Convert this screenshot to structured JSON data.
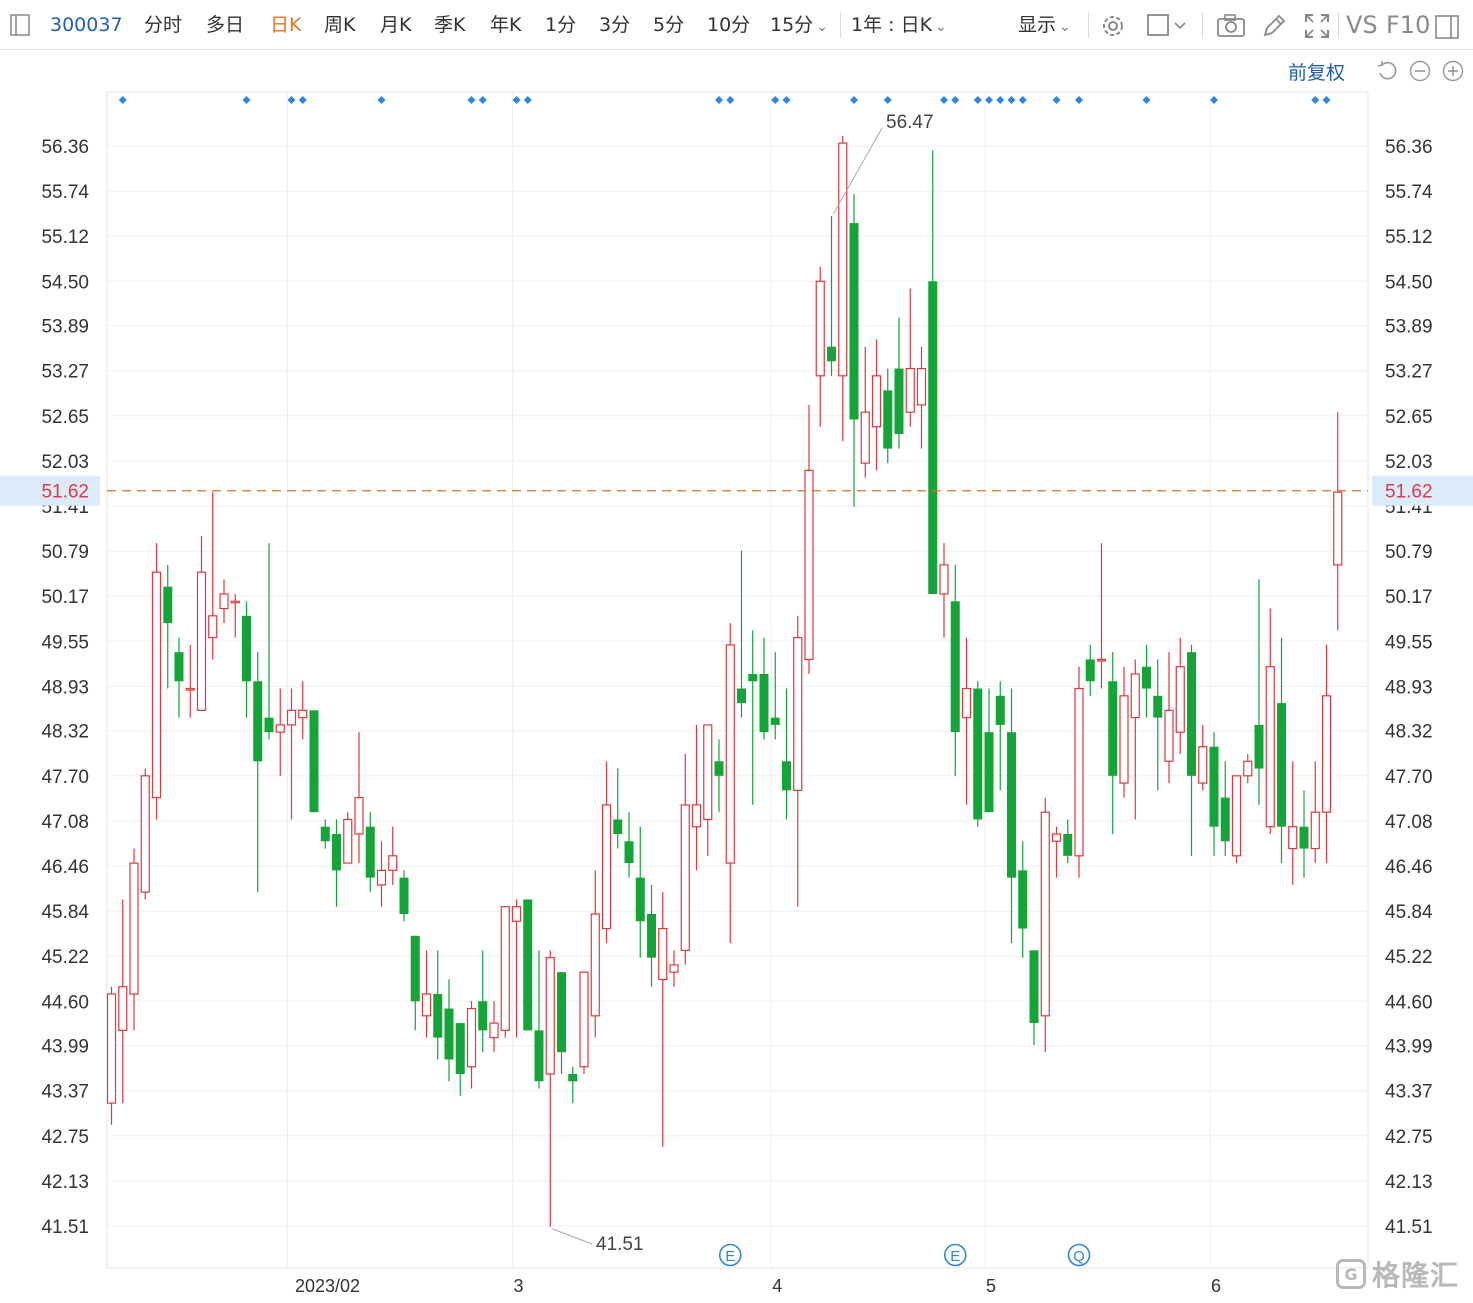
{
  "toolbar": {
    "code": "300037",
    "tabs": [
      "分时",
      "多日",
      "日K",
      "周K",
      "月K",
      "季K",
      "年K",
      "1分",
      "3分",
      "5分",
      "10分",
      "15分"
    ],
    "active_tab": "日K",
    "period": "1年 : 日K",
    "display": "显示",
    "vs": "VS",
    "f10": "F10"
  },
  "adjust_label": "前复权",
  "colors": {
    "up": "#e0393e",
    "down": "#13a538",
    "current": "#e8741b",
    "axis_text": "#333333",
    "link": "#1f5fb5"
  },
  "logo": {
    "text": "格隆汇"
  },
  "chart_data": {
    "type": "candlestick",
    "title": "",
    "xlabel": "",
    "ylabel": "",
    "y_ticks": [
      56.36,
      55.74,
      55.12,
      54.5,
      53.89,
      53.27,
      52.65,
      52.03,
      51.41,
      50.79,
      50.17,
      49.55,
      48.93,
      48.32,
      47.7,
      47.08,
      46.46,
      45.84,
      45.22,
      44.6,
      43.99,
      43.37,
      42.75,
      42.13,
      41.51
    ],
    "ylim": [
      41.51,
      56.36
    ],
    "x_tick_labels": [
      "2023/02",
      "3",
      "4",
      "5",
      "6"
    ],
    "x_tick_index": [
      16,
      36,
      59,
      78,
      98
    ],
    "current_price": 51.62,
    "max_label": "56.47",
    "min_label": "41.51",
    "max_index": 64,
    "min_index": 39,
    "event_markers": [
      {
        "label": "E",
        "index": 55
      },
      {
        "label": "E",
        "index": 75
      },
      {
        "label": "Q",
        "index": 86
      }
    ],
    "top_markers_index": [
      1,
      12,
      16,
      17,
      24,
      32,
      33,
      36,
      37,
      54,
      55,
      59,
      60,
      66,
      69,
      74,
      75,
      77,
      78,
      79,
      80,
      81,
      84,
      86,
      92,
      98,
      107,
      108
    ],
    "candles": [
      {
        "o": 43.2,
        "h": 44.8,
        "l": 42.9,
        "c": 44.7
      },
      {
        "o": 44.2,
        "h": 46.0,
        "l": 43.2,
        "c": 44.8
      },
      {
        "o": 44.7,
        "h": 46.7,
        "l": 44.2,
        "c": 46.5
      },
      {
        "o": 46.1,
        "h": 47.8,
        "l": 46.0,
        "c": 47.7
      },
      {
        "o": 47.4,
        "h": 50.9,
        "l": 47.1,
        "c": 50.5
      },
      {
        "o": 50.3,
        "h": 50.6,
        "l": 48.9,
        "c": 49.8
      },
      {
        "o": 49.4,
        "h": 49.6,
        "l": 48.5,
        "c": 49.0
      },
      {
        "o": 48.9,
        "h": 49.5,
        "l": 48.5,
        "c": 48.9
      },
      {
        "o": 48.6,
        "h": 51.0,
        "l": 48.6,
        "c": 50.5
      },
      {
        "o": 49.6,
        "h": 51.6,
        "l": 49.3,
        "c": 49.9
      },
      {
        "o": 50.0,
        "h": 50.4,
        "l": 49.8,
        "c": 50.2
      },
      {
        "o": 50.1,
        "h": 50.2,
        "l": 49.6,
        "c": 50.1
      },
      {
        "o": 49.9,
        "h": 50.1,
        "l": 48.5,
        "c": 49.0
      },
      {
        "o": 49.0,
        "h": 49.4,
        "l": 46.1,
        "c": 47.9
      },
      {
        "o": 48.5,
        "h": 50.9,
        "l": 48.2,
        "c": 48.3
      },
      {
        "o": 48.3,
        "h": 48.9,
        "l": 47.7,
        "c": 48.4
      },
      {
        "o": 48.4,
        "h": 48.9,
        "l": 47.1,
        "c": 48.6
      },
      {
        "o": 48.5,
        "h": 49.0,
        "l": 48.2,
        "c": 48.6
      },
      {
        "o": 48.6,
        "h": 48.6,
        "l": 47.2,
        "c": 47.2
      },
      {
        "o": 47.0,
        "h": 47.1,
        "l": 46.7,
        "c": 46.8
      },
      {
        "o": 46.9,
        "h": 47.1,
        "l": 45.9,
        "c": 46.4
      },
      {
        "o": 46.5,
        "h": 47.2,
        "l": 46.5,
        "c": 47.1
      },
      {
        "o": 46.9,
        "h": 48.3,
        "l": 46.5,
        "c": 47.4
      },
      {
        "o": 47.0,
        "h": 47.2,
        "l": 46.1,
        "c": 46.3
      },
      {
        "o": 46.2,
        "h": 46.8,
        "l": 45.9,
        "c": 46.4
      },
      {
        "o": 46.4,
        "h": 47.0,
        "l": 46.2,
        "c": 46.6
      },
      {
        "o": 46.3,
        "h": 46.4,
        "l": 45.7,
        "c": 45.8
      },
      {
        "o": 45.5,
        "h": 45.5,
        "l": 44.2,
        "c": 44.6
      },
      {
        "o": 44.4,
        "h": 45.3,
        "l": 44.1,
        "c": 44.7
      },
      {
        "o": 44.7,
        "h": 45.3,
        "l": 43.8,
        "c": 44.1
      },
      {
        "o": 44.5,
        "h": 44.9,
        "l": 43.5,
        "c": 43.8
      },
      {
        "o": 44.3,
        "h": 44.3,
        "l": 43.3,
        "c": 43.6
      },
      {
        "o": 43.7,
        "h": 44.6,
        "l": 43.4,
        "c": 44.5
      },
      {
        "o": 44.6,
        "h": 45.3,
        "l": 43.9,
        "c": 44.2
      },
      {
        "o": 44.1,
        "h": 44.6,
        "l": 43.9,
        "c": 44.3
      },
      {
        "o": 44.2,
        "h": 45.8,
        "l": 44.1,
        "c": 45.9
      },
      {
        "o": 45.7,
        "h": 46.0,
        "l": 44.1,
        "c": 45.9
      },
      {
        "o": 46.0,
        "h": 46.0,
        "l": 44.2,
        "c": 44.2
      },
      {
        "o": 44.2,
        "h": 45.3,
        "l": 43.4,
        "c": 43.5
      },
      {
        "o": 43.6,
        "h": 45.3,
        "l": 41.5,
        "c": 45.2
      },
      {
        "o": 45.0,
        "h": 45.0,
        "l": 43.6,
        "c": 43.9
      },
      {
        "o": 43.6,
        "h": 43.7,
        "l": 43.2,
        "c": 43.5
      },
      {
        "o": 43.7,
        "h": 44.7,
        "l": 43.6,
        "c": 45.0
      },
      {
        "o": 44.4,
        "h": 46.4,
        "l": 44.1,
        "c": 45.8
      },
      {
        "o": 45.6,
        "h": 47.9,
        "l": 45.4,
        "c": 47.3
      },
      {
        "o": 47.1,
        "h": 47.8,
        "l": 46.7,
        "c": 46.9
      },
      {
        "o": 46.8,
        "h": 47.2,
        "l": 46.3,
        "c": 46.5
      },
      {
        "o": 46.3,
        "h": 47.0,
        "l": 45.2,
        "c": 45.7
      },
      {
        "o": 45.8,
        "h": 46.2,
        "l": 44.8,
        "c": 45.2
      },
      {
        "o": 44.9,
        "h": 46.1,
        "l": 42.6,
        "c": 45.6
      },
      {
        "o": 45.0,
        "h": 45.3,
        "l": 44.8,
        "c": 45.1
      },
      {
        "o": 45.3,
        "h": 48.0,
        "l": 45.1,
        "c": 47.3
      },
      {
        "o": 47.0,
        "h": 48.4,
        "l": 46.4,
        "c": 47.3
      },
      {
        "o": 47.1,
        "h": 48.4,
        "l": 46.6,
        "c": 48.4
      },
      {
        "o": 47.9,
        "h": 48.2,
        "l": 47.2,
        "c": 47.7
      },
      {
        "o": 46.5,
        "h": 49.8,
        "l": 45.4,
        "c": 49.5
      },
      {
        "o": 48.9,
        "h": 50.8,
        "l": 48.5,
        "c": 48.7
      },
      {
        "o": 49.1,
        "h": 49.7,
        "l": 47.3,
        "c": 49.0
      },
      {
        "o": 49.1,
        "h": 49.6,
        "l": 48.2,
        "c": 48.3
      },
      {
        "o": 48.5,
        "h": 49.4,
        "l": 48.2,
        "c": 48.4
      },
      {
        "o": 47.9,
        "h": 48.9,
        "l": 47.1,
        "c": 47.5
      },
      {
        "o": 47.5,
        "h": 49.9,
        "l": 45.9,
        "c": 49.6
      },
      {
        "o": 49.3,
        "h": 52.8,
        "l": 49.1,
        "c": 51.9
      },
      {
        "o": 53.2,
        "h": 54.7,
        "l": 52.5,
        "c": 54.5
      },
      {
        "o": 53.6,
        "h": 55.4,
        "l": 53.2,
        "c": 53.4
      },
      {
        "o": 53.2,
        "h": 56.5,
        "l": 52.3,
        "c": 56.4
      },
      {
        "o": 55.3,
        "h": 55.7,
        "l": 51.4,
        "c": 52.6
      },
      {
        "o": 52.0,
        "h": 53.6,
        "l": 51.8,
        "c": 52.7
      },
      {
        "o": 52.5,
        "h": 53.7,
        "l": 51.9,
        "c": 53.2
      },
      {
        "o": 53.0,
        "h": 53.3,
        "l": 52.0,
        "c": 52.2
      },
      {
        "o": 53.3,
        "h": 54.0,
        "l": 52.2,
        "c": 52.4
      },
      {
        "o": 52.7,
        "h": 54.4,
        "l": 52.5,
        "c": 53.3
      },
      {
        "o": 52.8,
        "h": 53.6,
        "l": 52.2,
        "c": 53.3
      },
      {
        "o": 54.5,
        "h": 56.3,
        "l": 52.3,
        "c": 50.2
      },
      {
        "o": 50.2,
        "h": 50.9,
        "l": 49.6,
        "c": 50.6
      },
      {
        "o": 50.1,
        "h": 50.6,
        "l": 47.7,
        "c": 48.3
      },
      {
        "o": 48.5,
        "h": 49.6,
        "l": 47.3,
        "c": 48.9
      },
      {
        "o": 48.9,
        "h": 49.0,
        "l": 47.0,
        "c": 47.1
      },
      {
        "o": 48.3,
        "h": 48.9,
        "l": 47.2,
        "c": 47.2
      },
      {
        "o": 48.8,
        "h": 49.0,
        "l": 47.5,
        "c": 48.4
      },
      {
        "o": 48.3,
        "h": 48.9,
        "l": 45.4,
        "c": 46.3
      },
      {
        "o": 46.4,
        "h": 46.8,
        "l": 45.2,
        "c": 45.6
      },
      {
        "o": 45.3,
        "h": 45.3,
        "l": 44.0,
        "c": 44.3
      },
      {
        "o": 44.4,
        "h": 47.4,
        "l": 43.9,
        "c": 47.2
      },
      {
        "o": 46.8,
        "h": 47.0,
        "l": 46.3,
        "c": 46.9
      },
      {
        "o": 46.9,
        "h": 47.1,
        "l": 46.5,
        "c": 46.6
      },
      {
        "o": 46.6,
        "h": 49.2,
        "l": 46.3,
        "c": 48.9
      },
      {
        "o": 49.3,
        "h": 49.5,
        "l": 48.8,
        "c": 49.0
      },
      {
        "o": 49.3,
        "h": 50.9,
        "l": 48.9,
        "c": 49.3
      },
      {
        "o": 49.0,
        "h": 49.4,
        "l": 46.9,
        "c": 47.7
      },
      {
        "o": 47.6,
        "h": 49.2,
        "l": 47.4,
        "c": 48.8
      },
      {
        "o": 48.5,
        "h": 49.3,
        "l": 47.1,
        "c": 49.1
      },
      {
        "o": 49.2,
        "h": 49.5,
        "l": 48.5,
        "c": 48.9
      },
      {
        "o": 48.8,
        "h": 49.3,
        "l": 47.5,
        "c": 48.5
      },
      {
        "o": 47.9,
        "h": 49.4,
        "l": 47.6,
        "c": 48.6
      },
      {
        "o": 48.3,
        "h": 49.6,
        "l": 48.0,
        "c": 49.2
      },
      {
        "o": 49.4,
        "h": 49.5,
        "l": 46.6,
        "c": 47.7
      },
      {
        "o": 47.6,
        "h": 48.4,
        "l": 47.5,
        "c": 48.1
      },
      {
        "o": 48.1,
        "h": 48.3,
        "l": 46.6,
        "c": 47.0
      },
      {
        "o": 47.4,
        "h": 47.9,
        "l": 46.6,
        "c": 46.8
      },
      {
        "o": 46.6,
        "h": 47.7,
        "l": 46.5,
        "c": 47.7
      },
      {
        "o": 47.7,
        "h": 48.0,
        "l": 47.6,
        "c": 47.9
      },
      {
        "o": 48.4,
        "h": 50.4,
        "l": 47.3,
        "c": 47.8
      },
      {
        "o": 47.0,
        "h": 50.0,
        "l": 46.9,
        "c": 49.2
      },
      {
        "o": 48.7,
        "h": 49.6,
        "l": 46.5,
        "c": 47.0
      },
      {
        "o": 46.7,
        "h": 47.9,
        "l": 46.2,
        "c": 47.0
      },
      {
        "o": 47.0,
        "h": 47.5,
        "l": 46.3,
        "c": 46.7
      },
      {
        "o": 46.7,
        "h": 47.9,
        "l": 46.5,
        "c": 47.2
      },
      {
        "o": 47.2,
        "h": 49.5,
        "l": 46.5,
        "c": 48.8
      },
      {
        "o": 50.6,
        "h": 52.7,
        "l": 49.7,
        "c": 51.6
      }
    ]
  }
}
